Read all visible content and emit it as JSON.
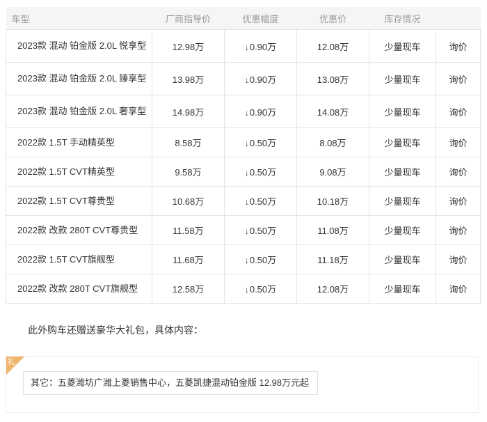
{
  "table": {
    "headers": {
      "model": "车型",
      "msrp": "厂商指导价",
      "discount": "优惠幅度",
      "promo_price": "优惠价",
      "stock": "库存情况"
    },
    "discount_arrow": "↓",
    "rows": [
      {
        "model": "2023款 混动 铂金版 2.0L 悦享型",
        "msrp": "12.98万",
        "discount": "0.90万",
        "promo_price": "12.08万",
        "stock": "少量现车",
        "action": "询价"
      },
      {
        "model": "2023款 混动 铂金版 2.0L 臻享型",
        "msrp": "13.98万",
        "discount": "0.90万",
        "promo_price": "13.08万",
        "stock": "少量现车",
        "action": "询价"
      },
      {
        "model": "2023款 混动 铂金版 2.0L 奢享型",
        "msrp": "14.98万",
        "discount": "0.90万",
        "promo_price": "14.08万",
        "stock": "少量现车",
        "action": "询价"
      },
      {
        "model": "2022款 1.5T 手动精英型",
        "msrp": "8.58万",
        "discount": "0.50万",
        "promo_price": "8.08万",
        "stock": "少量现车",
        "action": "询价"
      },
      {
        "model": "2022款 1.5T CVT精英型",
        "msrp": "9.58万",
        "discount": "0.50万",
        "promo_price": "9.08万",
        "stock": "少量现车",
        "action": "询价"
      },
      {
        "model": "2022款 1.5T CVT尊贵型",
        "msrp": "10.68万",
        "discount": "0.50万",
        "promo_price": "10.18万",
        "stock": "少量现车",
        "action": "询价"
      },
      {
        "model": "2022款 改款 280T CVT尊贵型",
        "msrp": "11.58万",
        "discount": "0.50万",
        "promo_price": "11.08万",
        "stock": "少量现车",
        "action": "询价"
      },
      {
        "model": "2022款 1.5T CVT旗舰型",
        "msrp": "11.68万",
        "discount": "0.50万",
        "promo_price": "11.18万",
        "stock": "少量现车",
        "action": "询价"
      },
      {
        "model": "2022款 改款 280T CVT旗舰型",
        "msrp": "12.58万",
        "discount": "0.50万",
        "promo_price": "12.08万",
        "stock": "少量现车",
        "action": "询价"
      }
    ]
  },
  "gift": {
    "intro": "此外购车还赠送豪华大礼包，具体内容：",
    "badge": "礼",
    "item": "其它：五菱潍坊广潍上菱销售中心，五菱凯捷混动铂金版 12.98万元起"
  },
  "colors": {
    "discount_green": "#3a9c2c",
    "promo_red": "#d8292b",
    "badge_orange": "#f0b56c"
  }
}
